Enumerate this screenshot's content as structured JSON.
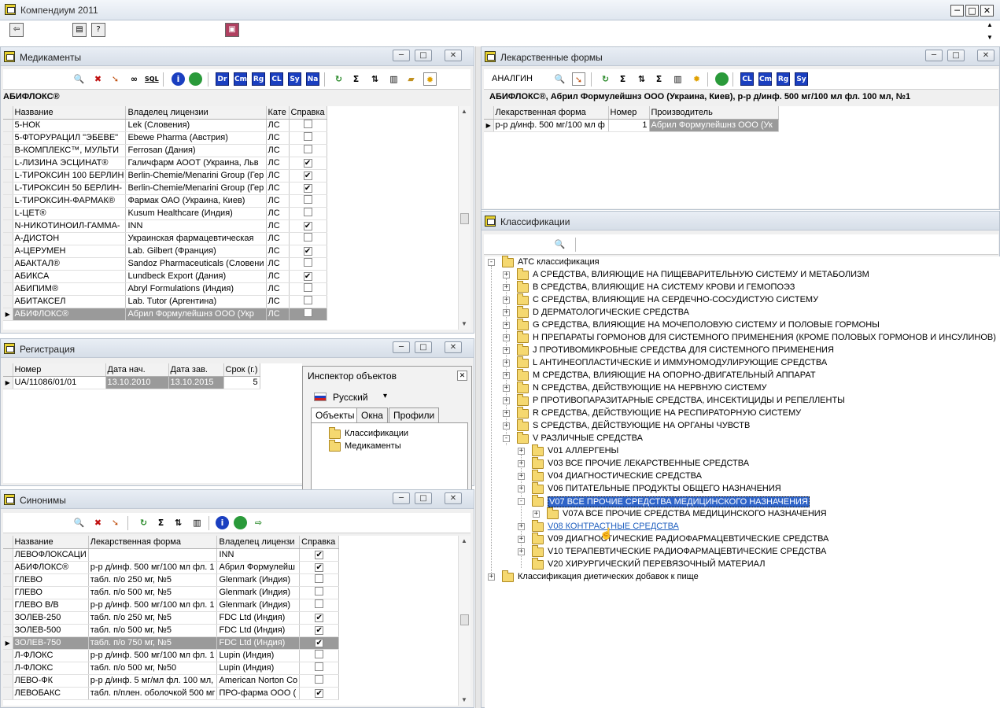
{
  "app": {
    "title": "Компендиум 2011"
  },
  "med": {
    "title": "Медикаменты",
    "current": "АБИФЛОКС®",
    "columns": [
      "Название",
      "Владелец лицензии",
      "Кате",
      "Справка"
    ],
    "rows": [
      {
        "n": "5-НОК",
        "o": "Lek (Словения)",
        "c": "ЛС",
        "s": ""
      },
      {
        "n": "5-ФТОРУРАЦИЛ \"ЭБЕВЕ\"",
        "o": "Ebewe Pharma (Австрия)",
        "c": "ЛС",
        "s": ""
      },
      {
        "n": "В-КОМПЛЕКС™, МУЛЬТИ",
        "o": "Ferrosan (Дания)",
        "c": "ЛС",
        "s": ""
      },
      {
        "n": "L-ЛИЗИНА ЭСЦИНАТ®",
        "o": "Галичфарм АООТ (Украина, Льв",
        "c": "ЛС",
        "s": "✔"
      },
      {
        "n": "L-ТИРОКСИН 100 БЕРЛИН",
        "o": "Berlin-Chemie/Menarini Group (Гер",
        "c": "ЛС",
        "s": "✔"
      },
      {
        "n": "L-ТИРОКСИН 50 БЕРЛИН-",
        "o": "Berlin-Chemie/Menarini Group (Гер",
        "c": "ЛС",
        "s": "✔"
      },
      {
        "n": "L-ТИРОКСИН-ФАРМАК®",
        "o": "Фармак ОАО (Украина, Киев)",
        "c": "ЛС",
        "s": ""
      },
      {
        "n": "L-ЦЕТ®",
        "o": "Kusum Healthcare (Индия)",
        "c": "ЛС",
        "s": ""
      },
      {
        "n": "N-НИКОТИНОИЛ-ГАММА-",
        "o": "INN",
        "c": "ЛС",
        "s": "✔"
      },
      {
        "n": "А-ДИСТОН",
        "o": "Украинская фармацевтическая",
        "c": "ЛС",
        "s": ""
      },
      {
        "n": "А-ЦЕРУМЕН",
        "o": "Lab. Gilbert (Франция)",
        "c": "ЛС",
        "s": "✔"
      },
      {
        "n": "АБАКТАЛ®",
        "o": "Sandoz Pharmaceuticals (Словени",
        "c": "ЛС",
        "s": ""
      },
      {
        "n": "АБИКСА",
        "o": "Lundbeck Export (Дания)",
        "c": "ЛС",
        "s": "✔"
      },
      {
        "n": "АБИПИМ®",
        "o": "Abryl Formulations (Индия)",
        "c": "ЛС",
        "s": ""
      },
      {
        "n": "АБИТАКСЕЛ",
        "o": "Lab. Tutor (Аргентина)",
        "c": "ЛС",
        "s": ""
      },
      {
        "n": "АБИФЛОКС®",
        "o": "Абрил Формулейшнз ООО (Укр",
        "c": "ЛС",
        "s": "",
        "sel": true
      }
    ]
  },
  "reg": {
    "title": "Регистрация",
    "columns": [
      "Номер",
      "Дата нач.",
      "Дата зав.",
      "Срок (г.)"
    ],
    "row": {
      "num": "UA/11086/01/01",
      "start": "13.10.2010",
      "end": "13.10.2015",
      "term": "5"
    }
  },
  "inspector": {
    "title": "Инспектор объектов",
    "language": "Русский",
    "tabs": [
      "Объекты",
      "Окна",
      "Профили"
    ],
    "items": [
      "Классификации",
      "Медикаменты"
    ]
  },
  "syn": {
    "title": "Синонимы",
    "columns": [
      "Название",
      "Лекарственная форма",
      "Владелец лицензи",
      "Справка"
    ],
    "rows": [
      {
        "n": "ЛЕВОФЛОКСАЦИ",
        "f": "",
        "o": "INN",
        "s": "✔"
      },
      {
        "n": "АБИФЛОКС®",
        "f": "р-р д/инф. 500 мг/100 мл фл. 1",
        "o": "Абрил Формулейш",
        "s": "✔"
      },
      {
        "n": "ГЛЕВО",
        "f": "табл. п/о 250 мг, №5",
        "o": "Glenmark (Индия)",
        "s": ""
      },
      {
        "n": "ГЛЕВО",
        "f": "табл. п/о 500 мг, №5",
        "o": "Glenmark (Индия)",
        "s": ""
      },
      {
        "n": "ГЛЕВО В/В",
        "f": "р-р д/инф. 500 мг/100 мл фл. 1",
        "o": "Glenmark (Индия)",
        "s": ""
      },
      {
        "n": "ЗОЛЕВ-250",
        "f": "табл. п/о 250 мг, №5",
        "o": "FDC Ltd (Индия)",
        "s": "✔"
      },
      {
        "n": "ЗОЛЕВ-500",
        "f": "табл. п/о 500 мг, №5",
        "o": "FDC Ltd (Индия)",
        "s": "✔"
      },
      {
        "n": "ЗОЛЕВ-750",
        "f": "табл. п/о 750 мг, №5",
        "o": "FDC Ltd (Индия)",
        "s": "✔",
        "sel": true
      },
      {
        "n": "Л-ФЛОКС",
        "f": "р-р д/инф. 500 мг/100 мл фл. 1",
        "o": "Lupin (Индия)",
        "s": ""
      },
      {
        "n": "Л-ФЛОКС",
        "f": "табл. п/о 500 мг, №50",
        "o": "Lupin (Индия)",
        "s": ""
      },
      {
        "n": "ЛЕВО-ФК",
        "f": "р-р д/инф. 5 мг/мл фл. 100 мл,",
        "o": "American Norton Co",
        "s": ""
      },
      {
        "n": "ЛЕВОБАКС",
        "f": "табл. п/плен. оболочкой 500 мг",
        "o": "ПРО-фарма ООО (",
        "s": "✔"
      }
    ]
  },
  "forms": {
    "title": "Лекарственные формы",
    "search": "АНАЛГИН",
    "description": "АБИФЛОКС®, Абрил Формулейшнз ООО (Украина, Киев), р-р д/инф. 500 мг/100 мл фл. 100 мл, №1",
    "columns": [
      "Лекарственная форма",
      "Номер",
      "Производитель"
    ],
    "row": {
      "form": "р-р д/инф. 500 мг/100 мл ф",
      "num": "1",
      "maker": "Абрил Формулейшнз ООО (Ук"
    }
  },
  "classif": {
    "title": "Классификации",
    "nodes": [
      {
        "label": "АТС классификация",
        "level": 0,
        "exp": "-"
      },
      {
        "label": "A СРЕДСТВА, ВЛИЯЮЩИЕ НА ПИЩЕВАРИТЕЛЬНУЮ СИСТЕМУ И МЕТАБОЛИЗМ",
        "level": 1,
        "exp": "+"
      },
      {
        "label": "B СРЕДСТВА, ВЛИЯЮЩИЕ НА СИСТЕМУ КРОВИ И ГЕМОПОЭЗ",
        "level": 1,
        "exp": "+"
      },
      {
        "label": "C СРЕДСТВА, ВЛИЯЮЩИЕ НА СЕРДЕЧНО-СОСУДИСТУЮ СИСТЕМУ",
        "level": 1,
        "exp": "+"
      },
      {
        "label": "D ДЕРМАТОЛОГИЧЕСКИЕ СРЕДСТВА",
        "level": 1,
        "exp": "+"
      },
      {
        "label": "G СРЕДСТВА, ВЛИЯЮЩИЕ НА МОЧЕПОЛОВУЮ СИСТЕМУ И ПОЛОВЫЕ ГОРМОНЫ",
        "level": 1,
        "exp": "+"
      },
      {
        "label": "H ПРЕПАРАТЫ ГОРМОНОВ ДЛЯ СИСТЕМНОГО ПРИМЕНЕНИЯ (КРОМЕ ПОЛОВЫХ ГОРМОНОВ И ИНСУЛИНОВ)",
        "level": 1,
        "exp": "+"
      },
      {
        "label": "J ПРОТИВОМИКРОБНЫЕ СРЕДСТВА ДЛЯ СИСТЕМНОГО ПРИМЕНЕНИЯ",
        "level": 1,
        "exp": "+"
      },
      {
        "label": "L АНТИНЕОПЛАСТИЧЕСКИЕ И ИММУНОМОДУЛИРУЮЩИЕ СРЕДСТВА",
        "level": 1,
        "exp": "+"
      },
      {
        "label": "M СРЕДСТВА, ВЛИЯЮЩИЕ НА ОПОРНО-ДВИГАТЕЛЬНЫЙ АППАРАТ",
        "level": 1,
        "exp": "+"
      },
      {
        "label": "N СРЕДСТВА, ДЕЙСТВУЮЩИЕ НА НЕРВНУЮ СИСТЕМУ",
        "level": 1,
        "exp": "+"
      },
      {
        "label": "P ПРОТИВОПАРАЗИТАРНЫЕ СРЕДСТВА, ИНСЕКТИЦИДЫ И РЕПЕЛЛЕНТЫ",
        "level": 1,
        "exp": "+"
      },
      {
        "label": "R СРЕДСТВА, ДЕЙСТВУЮЩИЕ НА РЕСПИРАТОРНУЮ СИСТЕМУ",
        "level": 1,
        "exp": "+"
      },
      {
        "label": "S СРЕДСТВА, ДЕЙСТВУЮЩИЕ НА ОРГАНЫ ЧУВСТВ",
        "level": 1,
        "exp": "+"
      },
      {
        "label": "V РАЗЛИЧНЫЕ СРЕДСТВА",
        "level": 1,
        "exp": "-"
      },
      {
        "label": "V01 АЛЛЕРГЕНЫ",
        "level": 2,
        "exp": "+"
      },
      {
        "label": "V03 ВСЕ ПРОЧИЕ ЛЕКАРСТВЕННЫЕ СРЕДСТВА",
        "level": 2,
        "exp": "+"
      },
      {
        "label": "V04 ДИАГНОСТИЧЕСКИЕ СРЕДСТВА",
        "level": 2,
        "exp": "+"
      },
      {
        "label": "V06 ПИТАТЕЛЬНЫЕ ПРОДУКТЫ ОБЩЕГО НАЗНАЧЕНИЯ",
        "level": 2,
        "exp": "+"
      },
      {
        "label": "V07 ВСЕ ПРОЧИЕ СРЕДСТВА МЕДИЦИНСКОГО НАЗНАЧЕНИЯ",
        "level": 2,
        "exp": "-",
        "style": "hl"
      },
      {
        "label": "V07A ВСЕ ПРОЧИЕ СРЕДСТВА МЕДИЦИНСКОГО НАЗНАЧЕНИЯ",
        "level": 3,
        "exp": "+"
      },
      {
        "label": "V08 КОНТРАСТНЫЕ СРЕДСТВА",
        "level": 2,
        "exp": "+",
        "style": "link"
      },
      {
        "label": "V09 ДИАГНОСТИЧЕСКИЕ РАДИОФАРМАЦЕВТИЧЕСКИЕ СРЕДСТВА",
        "level": 2,
        "exp": "+"
      },
      {
        "label": "V10 ТЕРАПЕВТИЧЕСКИЕ РАДИОФАРМАЦЕВТИЧЕСКИЕ СРЕДСТВА",
        "level": 2,
        "exp": "+"
      },
      {
        "label": "V20 ХИРУРГИЧЕСКИЙ ПЕРЕВЯЗОЧНЫЙ МАТЕРИАЛ",
        "level": 2,
        "exp": ""
      },
      {
        "label": "Классификация диетических добавок к пище",
        "level": 0,
        "exp": "+"
      }
    ]
  },
  "icons": {
    "search": "search-icon",
    "delete": "delete-icon",
    "filter": "filter-icon",
    "sum": "sum-icon",
    "sort": "sort-icon",
    "info": "info-icon",
    "globe": "globe-icon",
    "refresh": "refresh-icon"
  },
  "glyphs": {
    "min": "─",
    "max": "□",
    "close": "✕",
    "search": "🔍",
    "delete": "✖",
    "sigma": "Σ",
    "dd": "▾",
    "up": "▲",
    "down": "▼",
    "close_small": "✕",
    "ptr": "▶"
  },
  "btn": {
    "dr": "Dr",
    "cm": "Cm",
    "rg": "Rg",
    "cl": "CL",
    "sy": "Sy",
    "na": "Na",
    "sql": "SQL",
    "info": "i"
  }
}
